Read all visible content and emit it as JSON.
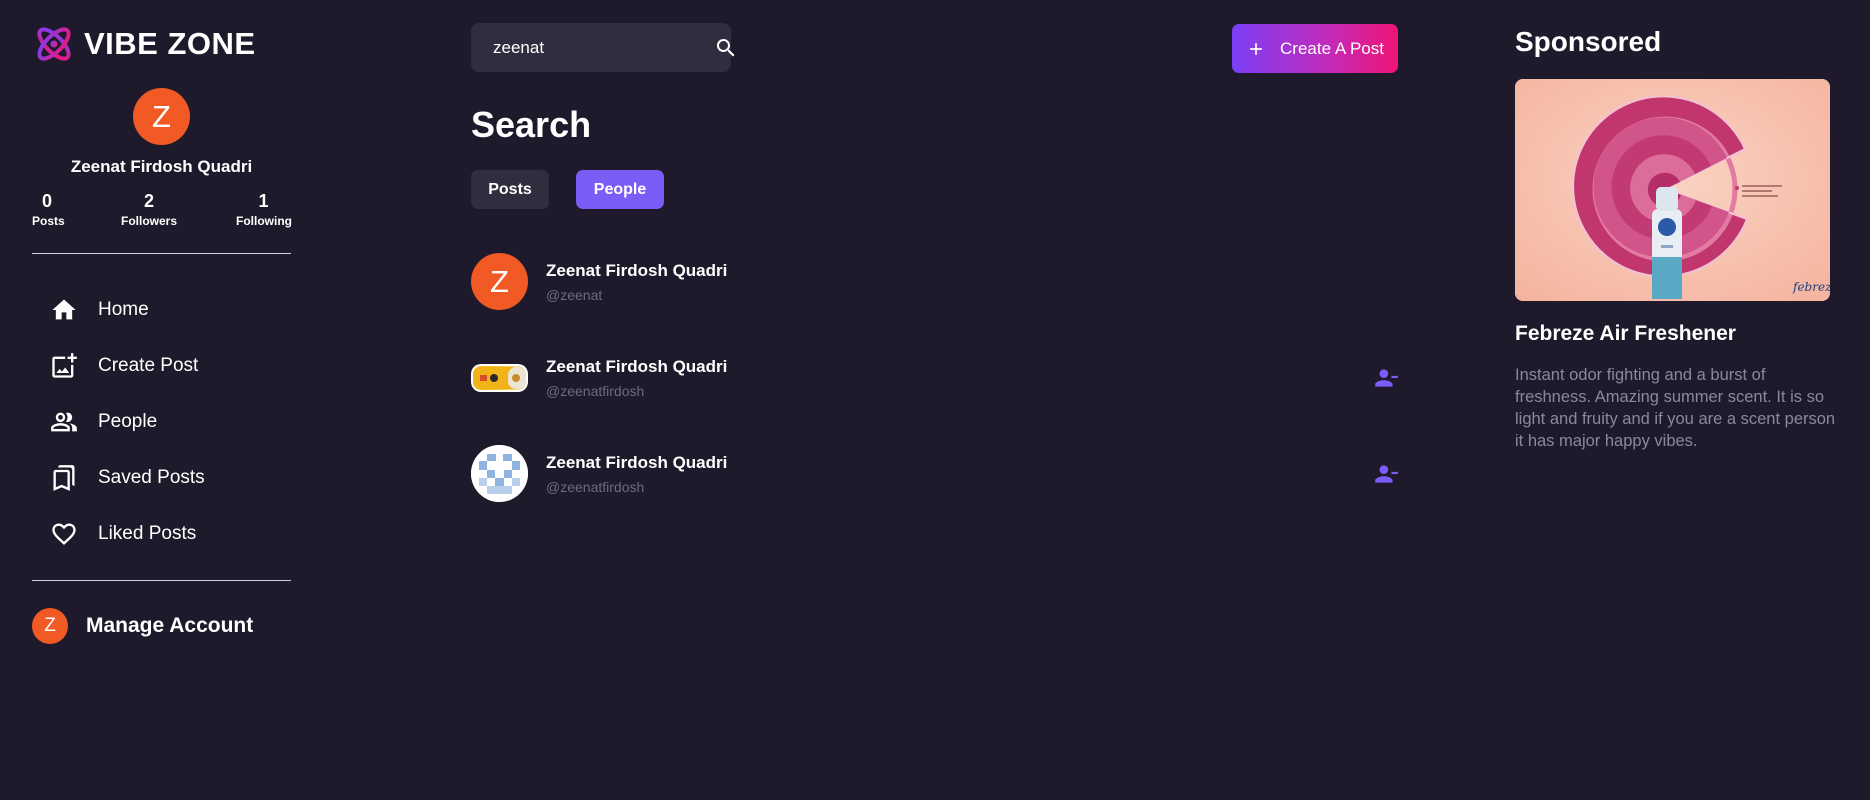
{
  "brand": {
    "name": "VIBE ZONE"
  },
  "profile": {
    "initial": "Z",
    "name": "Zeenat Firdosh Quadri",
    "stats": [
      {
        "value": "0",
        "label": "Posts"
      },
      {
        "value": "2",
        "label": "Followers"
      },
      {
        "value": "1",
        "label": "Following"
      }
    ]
  },
  "nav": {
    "items": [
      {
        "label": "Home",
        "icon": "home-icon"
      },
      {
        "label": "Create Post",
        "icon": "add-photo-icon"
      },
      {
        "label": "People",
        "icon": "people-icon"
      },
      {
        "label": "Saved Posts",
        "icon": "bookmarks-icon"
      },
      {
        "label": "Liked Posts",
        "icon": "heart-icon"
      }
    ],
    "manage_account": "Manage Account"
  },
  "search": {
    "value": "zeenat"
  },
  "header": {
    "create_label": "Create A Post"
  },
  "page": {
    "title": "Search",
    "tabs": [
      "Posts",
      "People"
    ],
    "active_tab": "People"
  },
  "results": [
    {
      "name": "Zeenat Firdosh Quadri",
      "handle": "@zeenat",
      "avatar": "Z",
      "action": ""
    },
    {
      "name": "Zeenat Firdosh Quadri",
      "handle": "@zeenatfirdosh",
      "avatar": "image",
      "action": "unfollow-icon"
    },
    {
      "name": "Zeenat Firdosh Quadri",
      "handle": "@zeenatfirdosh",
      "avatar": "image",
      "action": "unfollow-icon"
    }
  ],
  "sponsored": {
    "title": "Sponsored",
    "product": "Febreze Air Freshener",
    "description": "Instant odor fighting and a burst of freshness. Amazing summer scent. It is so light and fruity and if you are a scent person it has major happy vibes."
  },
  "colors": {
    "background": "#1e1a2b",
    "accent": "#7b5cf6",
    "avatar": "#f15a24",
    "gradient_start": "#7b3ff6",
    "gradient_end": "#f01474"
  }
}
